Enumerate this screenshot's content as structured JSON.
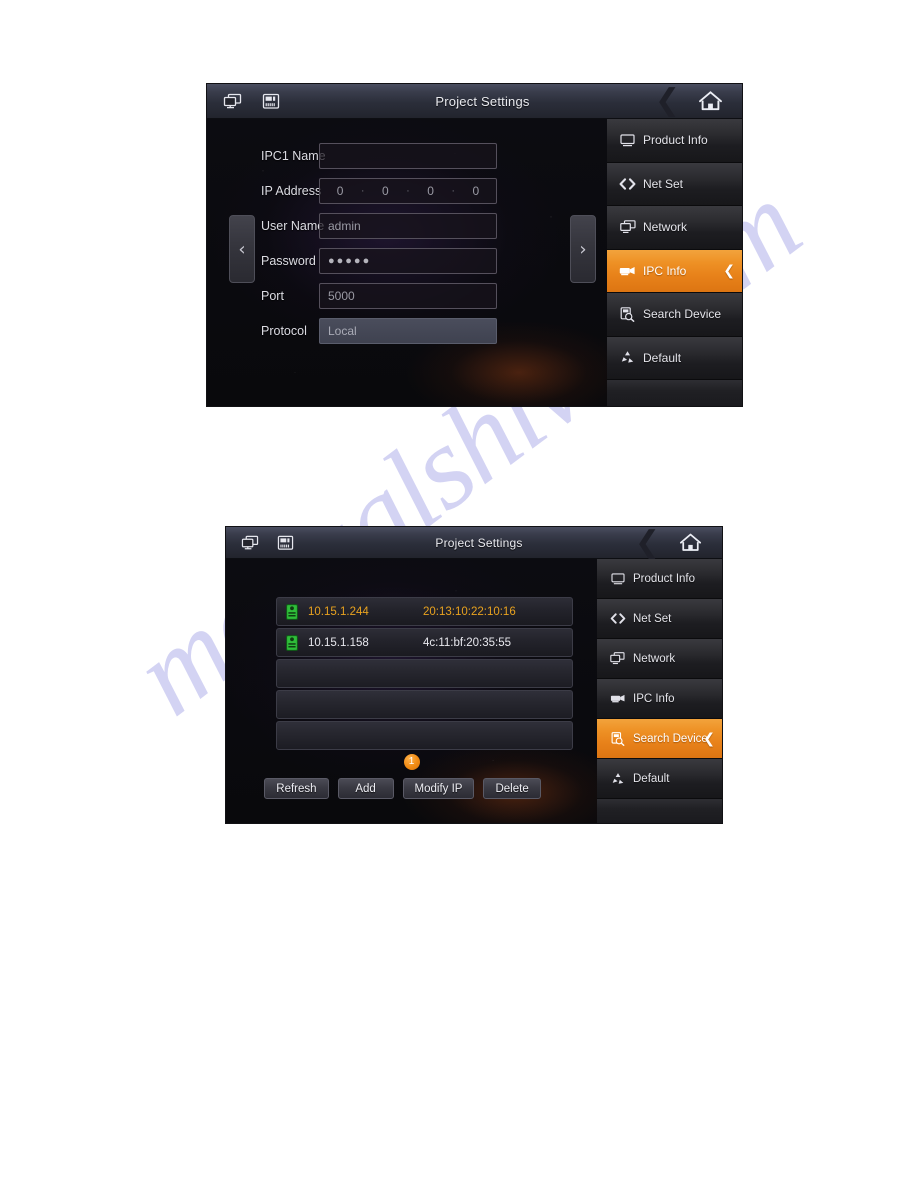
{
  "watermark": {
    "text": "manualshive.com"
  },
  "screens": [
    {
      "id": "ipc-info",
      "titlebar": {
        "title": "Project Settings",
        "icons": [
          "multi-screen-icon",
          "device-panel-icon"
        ],
        "back_icon": "chevron-left-icon",
        "home_icon": "home-icon"
      },
      "nav": {
        "prev": "‹",
        "next": "›"
      },
      "form": {
        "rows": [
          {
            "label": "IPC1 Name",
            "type": "text",
            "value": "",
            "placeholder": ""
          },
          {
            "label": "IP Address",
            "type": "ip",
            "octets": [
              "0",
              "0",
              "0",
              "0"
            ]
          },
          {
            "label": "User Name",
            "type": "text",
            "value": "admin"
          },
          {
            "label": "Password",
            "type": "password",
            "value": "●●●●●"
          },
          {
            "label": "Port",
            "type": "text",
            "value": "5000"
          },
          {
            "label": "Protocol",
            "type": "dropdown",
            "value": "Local"
          }
        ]
      },
      "sidebar": {
        "items": [
          {
            "label": "Product Info",
            "icon": "monitor-icon",
            "active": false
          },
          {
            "label": "Net Set",
            "icon": "code-brackets-icon",
            "active": false
          },
          {
            "label": "Network",
            "icon": "network-icon",
            "active": false
          },
          {
            "label": "IPC Info",
            "icon": "camera-icon",
            "active": true,
            "caret": "❮"
          },
          {
            "label": "Search Device",
            "icon": "search-device-icon",
            "active": false
          },
          {
            "label": "Default",
            "icon": "recycle-icon",
            "active": false
          }
        ]
      }
    },
    {
      "id": "search-device",
      "titlebar": {
        "title": "Project Settings",
        "icons": [
          "multi-screen-icon",
          "device-panel-icon"
        ],
        "back_icon": "chevron-left-icon",
        "home_icon": "home-icon"
      },
      "device_list": {
        "columns": [
          "ip",
          "mac"
        ],
        "rows": [
          {
            "ip": "10.15.1.244",
            "mac": "20:13:10:22:10:16",
            "selected": true,
            "icon": "device-online-icon"
          },
          {
            "ip": "10.15.1.158",
            "mac": "4c:11:bf:20:35:55",
            "selected": false,
            "icon": "device-online-icon"
          },
          {
            "ip": "",
            "mac": "",
            "selected": false,
            "icon": ""
          },
          {
            "ip": "",
            "mac": "",
            "selected": false,
            "icon": ""
          },
          {
            "ip": "",
            "mac": "",
            "selected": false,
            "icon": ""
          }
        ]
      },
      "pager": {
        "current": "1"
      },
      "buttons": [
        {
          "label": "Refresh"
        },
        {
          "label": "Add"
        },
        {
          "label": "Modify IP"
        },
        {
          "label": "Delete"
        }
      ],
      "sidebar": {
        "items": [
          {
            "label": "Product Info",
            "icon": "monitor-icon",
            "active": false
          },
          {
            "label": "Net Set",
            "icon": "code-brackets-icon",
            "active": false
          },
          {
            "label": "Network",
            "icon": "network-icon",
            "active": false
          },
          {
            "label": "IPC Info",
            "icon": "camera-icon",
            "active": false
          },
          {
            "label": "Search Device",
            "icon": "search-device-icon",
            "active": true,
            "caret": "❮"
          },
          {
            "label": "Default",
            "icon": "recycle-icon",
            "active": false
          }
        ]
      }
    }
  ],
  "colors": {
    "accent_orange": "#e8821a",
    "selected_row_text": "#e8a21f",
    "panel_bg": "#0a0a0d",
    "titlebar_top": "#4a4e60",
    "watermark": "#787adc"
  }
}
